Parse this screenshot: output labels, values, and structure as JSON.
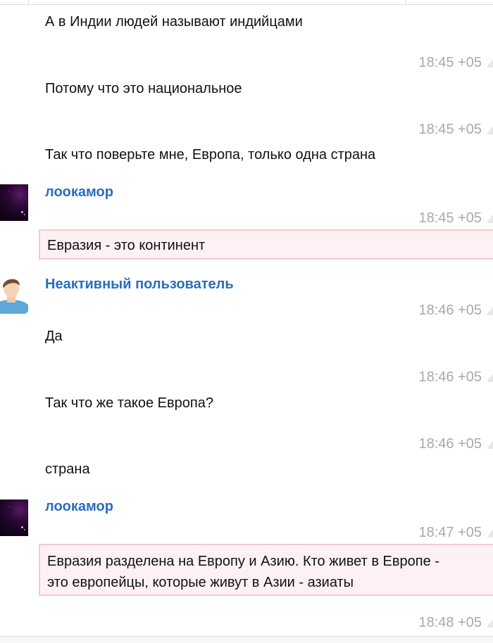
{
  "messages": [
    {
      "text": "А в Индии людей называют индийцами",
      "time": "18:45 +05"
    },
    {
      "text": "Потому что это национальное",
      "time": "18:45 +05"
    },
    {
      "text": "Так что поверьте мне, Европа, только одна страна"
    },
    {
      "author": "лоокамор",
      "time": "18:45 +05",
      "quote": "Евразия - это континент"
    },
    {
      "author": "Неактивный пользователь",
      "time": "18:46 +05"
    },
    {
      "text": "Да",
      "time": "18:46 +05"
    },
    {
      "text": "Так что же такое Европа?",
      "time": "18:46 +05"
    },
    {
      "text": "страна"
    },
    {
      "author": "лоокамор",
      "time": "18:47 +05",
      "quote_lines": [
        "Евразия разделена на Европу и Азию. Кто живет в Европе -",
        "это европейцы, которые живут в Азии - азиаты"
      ]
    },
    {
      "time": "18:48 +05"
    }
  ],
  "icons": {
    "space_avatar": "space-avatar-icon",
    "user_avatar": "default-user-avatar-icon",
    "message_menu": "message-menu-triangle-icon"
  },
  "colors": {
    "author_link": "#2a6cbf",
    "timestamp": "#a9a9a9",
    "quote_background": "#fdf1f3",
    "quote_border": "#f5c8cf"
  }
}
